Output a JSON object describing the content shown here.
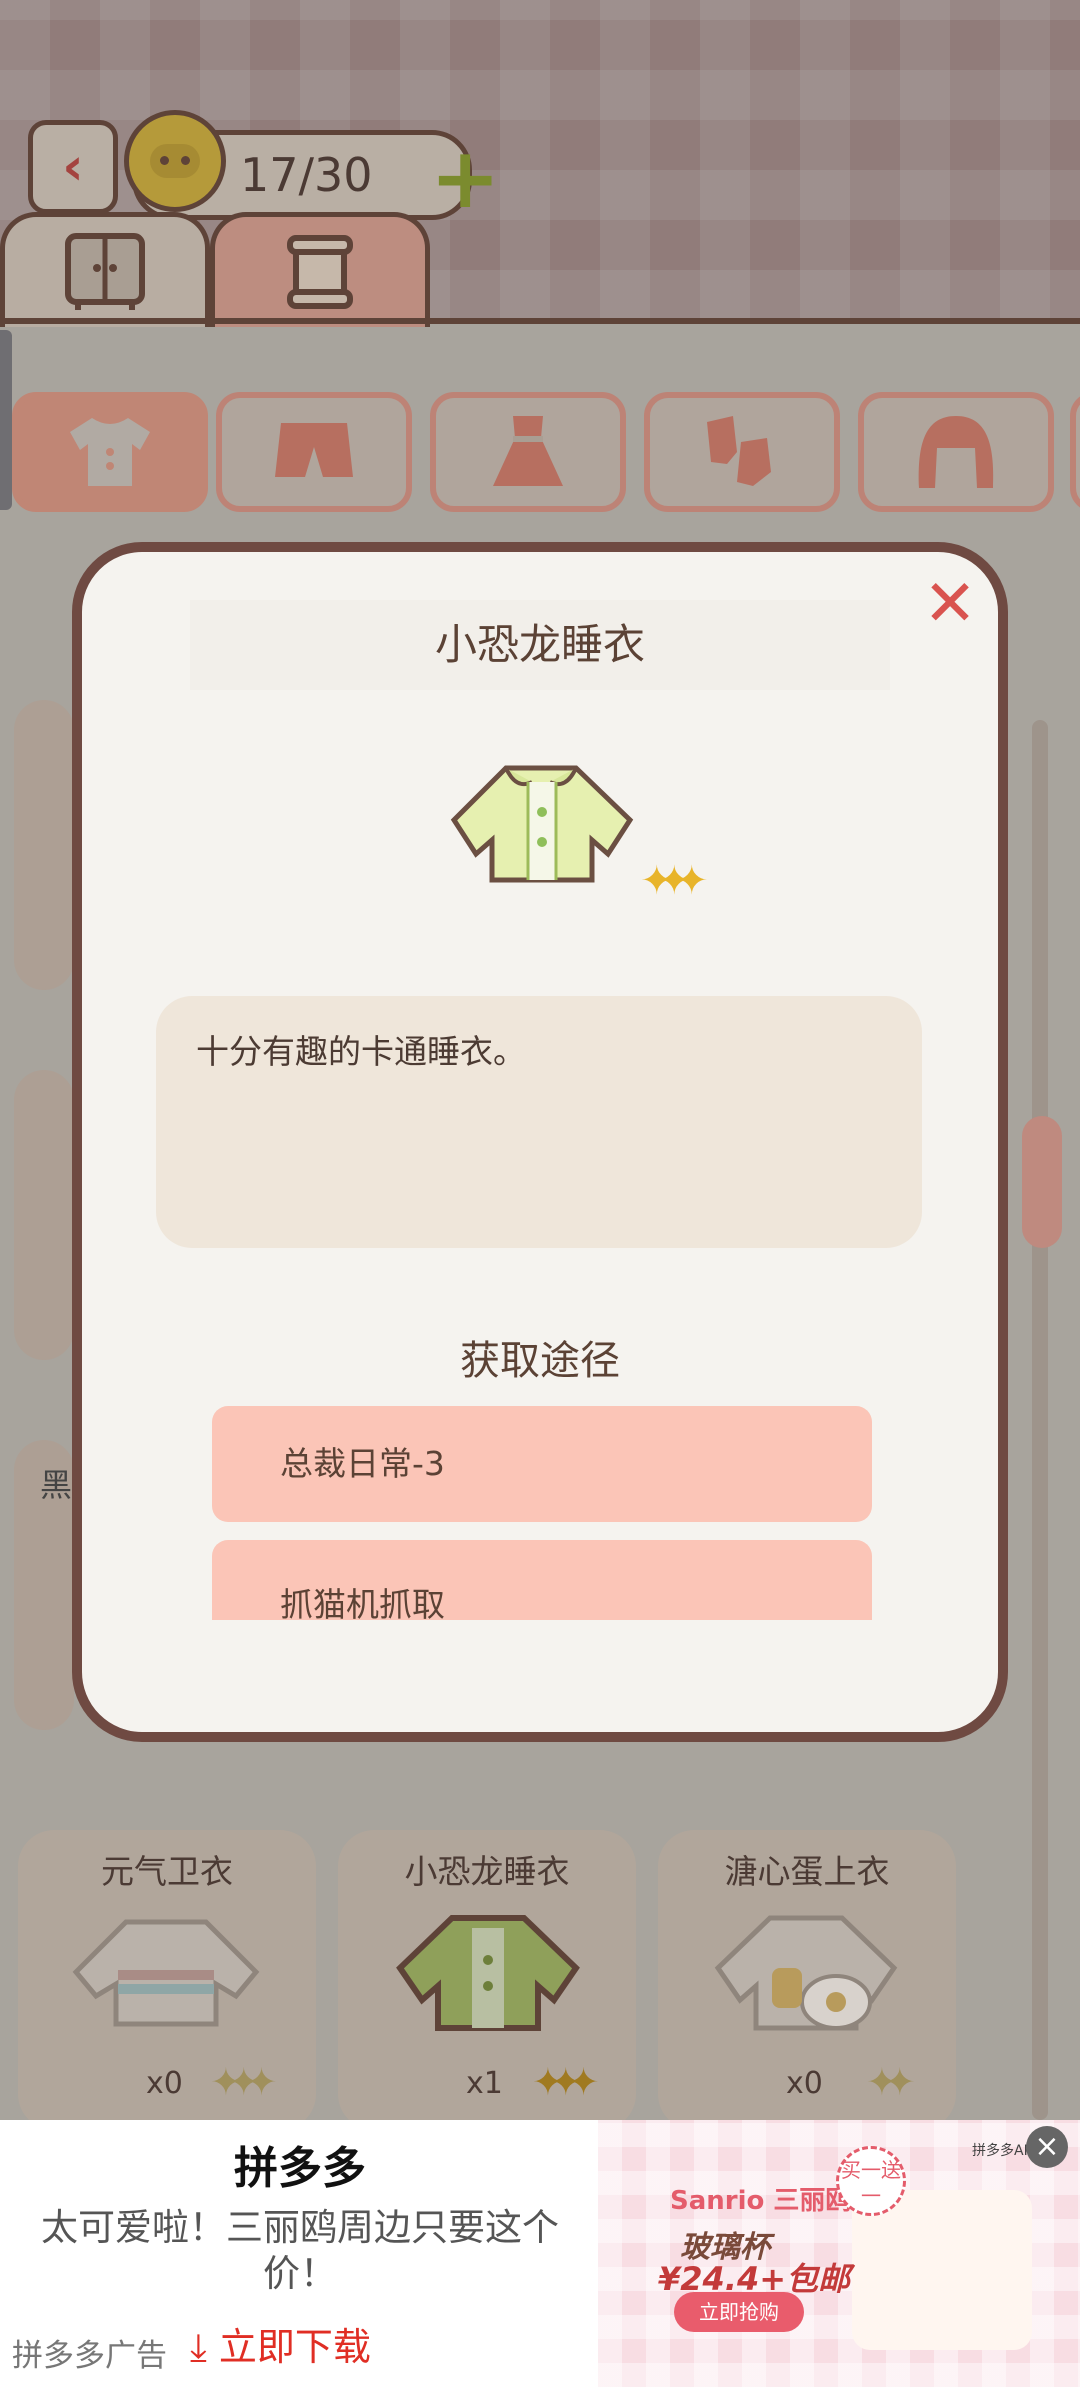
{
  "header": {
    "coins": "17/30"
  },
  "modal": {
    "title": "小恐龙睡衣",
    "description": "十分有趣的卡通睡衣。",
    "acquire_title": "获取途径",
    "routes": [
      "总裁日常-3",
      "抓猫机抓取"
    ]
  },
  "side_label": "黑",
  "items": [
    {
      "name": "元气卫衣",
      "count": "x0",
      "stars": 3
    },
    {
      "name": "小恐龙睡衣",
      "count": "x1",
      "stars": 3
    },
    {
      "name": "溏心蛋上衣",
      "count": "x0",
      "stars": 2
    }
  ],
  "ad": {
    "app_name": "拼多多",
    "description": "太可爱啦！三丽鸥周边只要这个价！",
    "source": "拼多多广告",
    "download": "⤓ 立即下载",
    "brand": "Sanrio 三丽鸥",
    "product": "玻璃杯",
    "price": "¥24.4+包邮",
    "cta": "立即抢购",
    "badge": "买一送一",
    "small_text": "拼多多APP"
  },
  "colors": {
    "accent": "#d9534f",
    "route_bg": "#fbc5b7",
    "modal_border": "#6f4a42"
  }
}
